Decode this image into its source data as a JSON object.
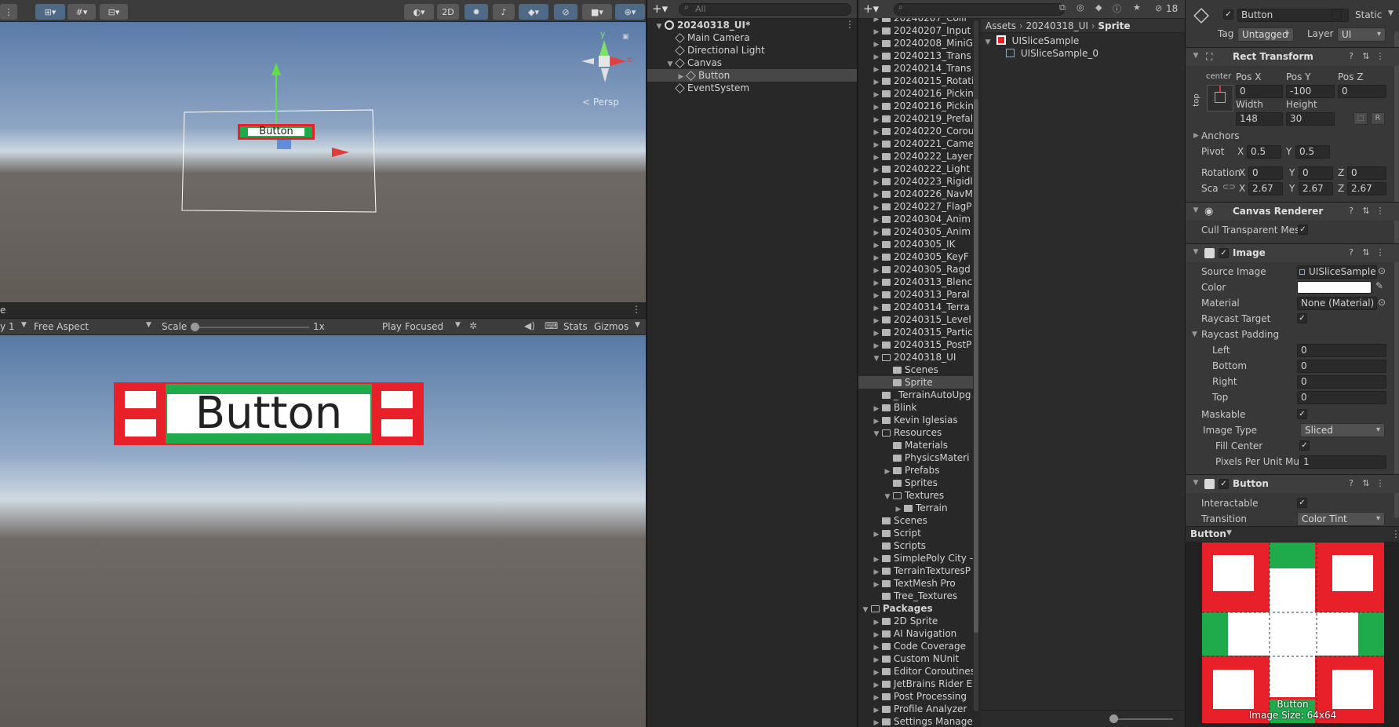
{
  "scene": {
    "toolbar": {
      "mode_2d": "2D"
    },
    "persp_label": "< Persp",
    "gizmo_x": "x",
    "gizmo_y": "y",
    "button_text": "Button"
  },
  "game": {
    "tab_fragment": "e",
    "display_fragment": "y 1",
    "aspect": "Free Aspect",
    "scale_label": "Scale",
    "scale_value": "1x",
    "play_focused": "Play Focused",
    "stats": "Stats",
    "gizmos": "Gizmos",
    "button_text": "Button"
  },
  "hierarchy": {
    "search_placeholder": "All",
    "items": [
      {
        "label": "20240318_UI*",
        "indent": 0,
        "fold": "▼",
        "kind": "scene",
        "bold": true
      },
      {
        "label": "Main Camera",
        "indent": 1,
        "fold": "",
        "kind": "cube"
      },
      {
        "label": "Directional Light",
        "indent": 1,
        "fold": "",
        "kind": "cube"
      },
      {
        "label": "Canvas",
        "indent": 1,
        "fold": "▼",
        "kind": "cube"
      },
      {
        "label": "Button",
        "indent": 2,
        "fold": "▶",
        "kind": "cube",
        "selected": true
      },
      {
        "label": "EventSystem",
        "indent": 1,
        "fold": "",
        "kind": "cube"
      }
    ]
  },
  "project": {
    "breadcrumb": [
      "Assets",
      "20240318_UI",
      "Sprite"
    ],
    "badge_count": "18",
    "tree": [
      {
        "label": "20240207_Colli",
        "indent": 1,
        "fold": "▶"
      },
      {
        "label": "20240207_Input",
        "indent": 1,
        "fold": "▶"
      },
      {
        "label": "20240208_MiniG",
        "indent": 1,
        "fold": "▶"
      },
      {
        "label": "20240213_Trans",
        "indent": 1,
        "fold": "▶"
      },
      {
        "label": "20240214_Trans",
        "indent": 1,
        "fold": "▶"
      },
      {
        "label": "20240215_Rotati",
        "indent": 1,
        "fold": "▶"
      },
      {
        "label": "20240216_Pickin",
        "indent": 1,
        "fold": "▶"
      },
      {
        "label": "20240216_Pickin",
        "indent": 1,
        "fold": "▶"
      },
      {
        "label": "20240219_Prefal",
        "indent": 1,
        "fold": "▶"
      },
      {
        "label": "20240220_Corou",
        "indent": 1,
        "fold": "▶"
      },
      {
        "label": "20240221_Came",
        "indent": 1,
        "fold": "▶"
      },
      {
        "label": "20240222_Layer",
        "indent": 1,
        "fold": "▶"
      },
      {
        "label": "20240222_Light",
        "indent": 1,
        "fold": "▶"
      },
      {
        "label": "20240223_Rigidl",
        "indent": 1,
        "fold": "▶"
      },
      {
        "label": "20240226_NavM",
        "indent": 1,
        "fold": "▶"
      },
      {
        "label": "20240227_FlagP",
        "indent": 1,
        "fold": "▶"
      },
      {
        "label": "20240304_Anim",
        "indent": 1,
        "fold": "▶"
      },
      {
        "label": "20240305_Anim",
        "indent": 1,
        "fold": "▶"
      },
      {
        "label": "20240305_IK",
        "indent": 1,
        "fold": "▶"
      },
      {
        "label": "20240305_KeyF",
        "indent": 1,
        "fold": "▶"
      },
      {
        "label": "20240305_Ragd",
        "indent": 1,
        "fold": "▶"
      },
      {
        "label": "20240313_Blenc",
        "indent": 1,
        "fold": "▶"
      },
      {
        "label": "20240313_Paral",
        "indent": 1,
        "fold": "▶"
      },
      {
        "label": "20240314_Terra",
        "indent": 1,
        "fold": "▶"
      },
      {
        "label": "20240315_Level",
        "indent": 1,
        "fold": "▶"
      },
      {
        "label": "20240315_Partic",
        "indent": 1,
        "fold": "▶"
      },
      {
        "label": "20240315_PostP",
        "indent": 1,
        "fold": "▶"
      },
      {
        "label": "20240318_UI",
        "indent": 1,
        "fold": "▼",
        "open": true
      },
      {
        "label": "Scenes",
        "indent": 2,
        "fold": ""
      },
      {
        "label": "Sprite",
        "indent": 2,
        "fold": "",
        "selected": true
      },
      {
        "label": "_TerrainAutoUpg",
        "indent": 1,
        "fold": ""
      },
      {
        "label": "Blink",
        "indent": 1,
        "fold": "▶"
      },
      {
        "label": "Kevin Iglesias",
        "indent": 1,
        "fold": "▶"
      },
      {
        "label": "Resources",
        "indent": 1,
        "fold": "▼",
        "open": true
      },
      {
        "label": "Materials",
        "indent": 2,
        "fold": ""
      },
      {
        "label": "PhysicsMateri",
        "indent": 2,
        "fold": ""
      },
      {
        "label": "Prefabs",
        "indent": 2,
        "fold": "▶"
      },
      {
        "label": "Sprites",
        "indent": 2,
        "fold": ""
      },
      {
        "label": "Textures",
        "indent": 2,
        "fold": "▼",
        "open": true
      },
      {
        "label": "Terrain",
        "indent": 3,
        "fold": "▶"
      },
      {
        "label": "Scenes",
        "indent": 1,
        "fold": ""
      },
      {
        "label": "Script",
        "indent": 1,
        "fold": "▶"
      },
      {
        "label": "Scripts",
        "indent": 1,
        "fold": ""
      },
      {
        "label": "SimplePoly City -",
        "indent": 1,
        "fold": "▶"
      },
      {
        "label": "TerrainTexturesP",
        "indent": 1,
        "fold": "▶"
      },
      {
        "label": "TextMesh Pro",
        "indent": 1,
        "fold": "▶"
      },
      {
        "label": "Tree_Textures",
        "indent": 1,
        "fold": ""
      },
      {
        "label": "Packages",
        "indent": 0,
        "fold": "▼",
        "open": true,
        "bold": true
      },
      {
        "label": "2D Sprite",
        "indent": 1,
        "fold": "▶"
      },
      {
        "label": "AI Navigation",
        "indent": 1,
        "fold": "▶"
      },
      {
        "label": "Code Coverage",
        "indent": 1,
        "fold": "▶"
      },
      {
        "label": "Custom NUnit",
        "indent": 1,
        "fold": "▶"
      },
      {
        "label": "Editor Coroutines",
        "indent": 1,
        "fold": "▶"
      },
      {
        "label": "JetBrains Rider E",
        "indent": 1,
        "fold": "▶"
      },
      {
        "label": "Post Processing",
        "indent": 1,
        "fold": "▶"
      },
      {
        "label": "Profile Analyzer",
        "indent": 1,
        "fold": "▶"
      },
      {
        "label": "Settings Manage",
        "indent": 1,
        "fold": "▶"
      }
    ],
    "assets": [
      {
        "label": "UISliceSample",
        "indent": 0
      },
      {
        "label": "UISliceSample_0",
        "indent": 1
      }
    ]
  },
  "inspector": {
    "name": "Button",
    "static": "Static",
    "tag_label": "Tag",
    "tag_value": "Untagged",
    "layer_label": "Layer",
    "layer_value": "UI",
    "rect": {
      "title": "Rect Transform",
      "anchor_h": "center",
      "anchor_v": "top",
      "posx_l": "Pos X",
      "posy_l": "Pos Y",
      "posz_l": "Pos Z",
      "posx": "0",
      "posy": "-100",
      "posz": "0",
      "width_l": "Width",
      "height_l": "Height",
      "width": "148",
      "height": "30",
      "r_btn": "R",
      "anchors": "Anchors",
      "pivot": "Pivot",
      "pivot_x": "0.5",
      "pivot_y": "0.5",
      "rotation": "Rotation",
      "rot_x": "0",
      "rot_y": "0",
      "rot_z": "0",
      "scale": "Sca",
      "sc_x": "2.67",
      "sc_y": "2.67",
      "sc_z": "2.67",
      "x": "X",
      "y": "Y",
      "z": "Z"
    },
    "canvas_renderer": {
      "title": "Canvas Renderer",
      "cull": "Cull Transparent Mes"
    },
    "image": {
      "title": "Image",
      "source_l": "Source Image",
      "source": "UISliceSample",
      "color_l": "Color",
      "material_l": "Material",
      "material": "None (Material)",
      "raycast_target": "Raycast Target",
      "raycast_padding": "Raycast Padding",
      "left": "Left",
      "bottom": "Bottom",
      "right": "Right",
      "top": "Top",
      "left_v": "0",
      "bottom_v": "0",
      "right_v": "0",
      "top_v": "0",
      "maskable": "Maskable",
      "image_type_l": "Image Type",
      "image_type": "Sliced",
      "fill_center": "Fill Center",
      "ppu_l": "Pixels Per Unit Mul",
      "ppu": "1"
    },
    "button": {
      "title": "Button",
      "interactable": "Interactable",
      "transition_l": "Transition",
      "transition": "Color Tint"
    },
    "preview": {
      "title": "Button",
      "label": "Button",
      "size": "Image Size: 64x64"
    }
  },
  "colors": {
    "red": "#e8202a",
    "green": "#1faa4b",
    "select": "#2c5d87"
  }
}
